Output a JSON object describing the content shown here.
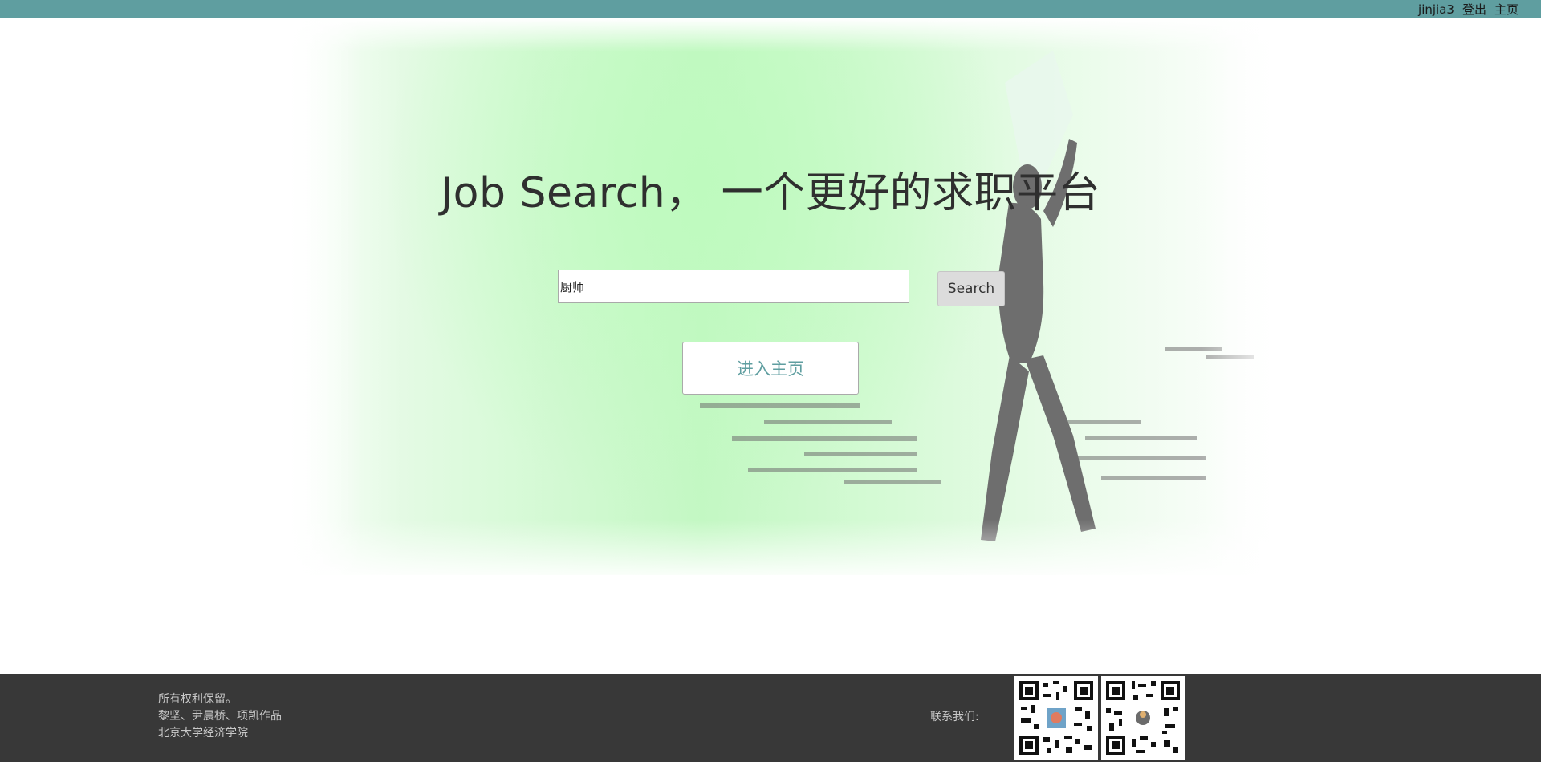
{
  "topbar": {
    "username": "jinjia3",
    "logout_label": "登出",
    "home_label": "主页",
    "background_color": "#5f9ea0"
  },
  "hero": {
    "title": "Job Search， 一个更好的求职平台",
    "search": {
      "value": "厨师",
      "button_label": "Search"
    },
    "home_button_label": "进入主页",
    "accent_color": "#5f9ea0"
  },
  "footer": {
    "lines": [
      "所有权利保留。",
      "黎坚、尹晨桥、项凯作品",
      "北京大学经济学院"
    ],
    "contact_label": "联系我们:",
    "qr_codes": [
      "qr-code-icon",
      "qr-code-icon"
    ]
  }
}
